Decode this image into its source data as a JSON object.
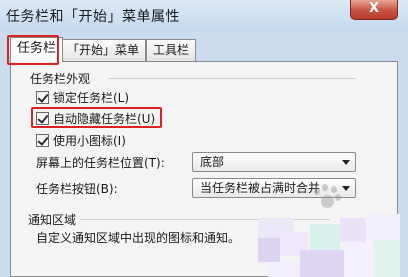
{
  "window": {
    "title": "任务栏和「开始」菜单属性",
    "close_glyph": "X"
  },
  "tabs": [
    {
      "label": "任务栏"
    },
    {
      "label": "「开始」菜单"
    },
    {
      "label": "工具栏"
    }
  ],
  "appearance": {
    "group_label": "任务栏外观",
    "lock_taskbar": {
      "label": "锁定任务栏(L)",
      "checked": true
    },
    "auto_hide": {
      "label": "自动隐藏任务栏(U)",
      "checked": true
    },
    "small_icons": {
      "label": "使用小图标(I)",
      "checked": true
    },
    "position": {
      "label": "屏幕上的任务栏位置(T):",
      "value": "底部"
    },
    "buttons": {
      "label": "任务栏按钮(B):",
      "value": "当任务栏被占满时合并"
    }
  },
  "notification": {
    "group_label": "通知区域",
    "description": "自定义通知区域中出现的图标和通知。"
  },
  "colors": {
    "highlight_border": "#d9241f"
  }
}
